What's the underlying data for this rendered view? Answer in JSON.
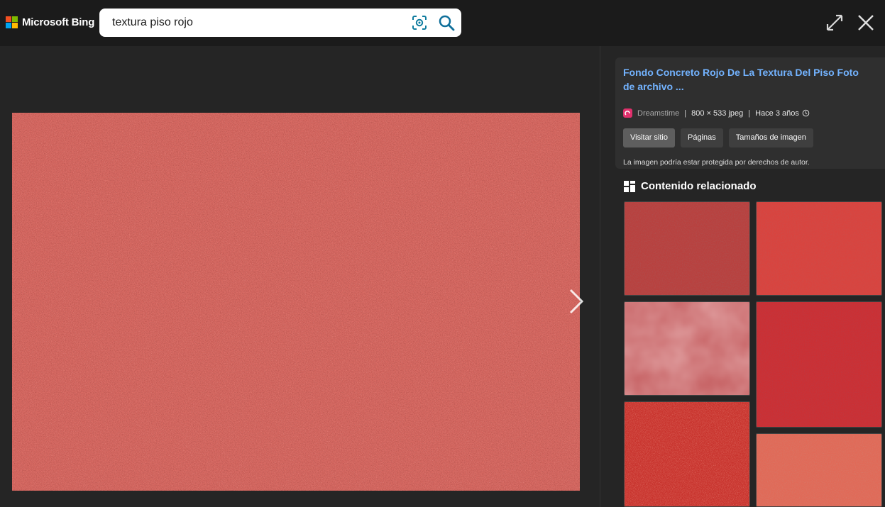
{
  "header": {
    "logo_text": "Microsoft Bing",
    "search_value": "textura piso rojo",
    "icons": {
      "visual_search": "visual-search-icon",
      "search": "search-icon",
      "expand": "expand-icon",
      "close": "close-icon"
    }
  },
  "viewer": {
    "next_icon": "chevron-right-icon",
    "image_color": "#d96a63"
  },
  "details": {
    "title": "Fondo Concreto Rojo De La Textura Del Piso Foto de archivo ...",
    "source": "Dreamstime",
    "dimensions": "800 × 533 jpeg",
    "age": "Hace 3 años",
    "buttons": {
      "visit": "Visitar sitio",
      "pages": "Páginas",
      "sizes": "Tamaños de imagen"
    },
    "copyright": "La imagen podría estar protegida por derechos de autor."
  },
  "related": {
    "heading": "Contenido relacionado",
    "thumb_colors": [
      "#b8413f",
      "#d8443f",
      "#c86668",
      "#cc2f33",
      "#c8332d",
      "#e06a58"
    ]
  },
  "colors": {
    "link": "#73b3ff",
    "background": "#252525",
    "topbar": "#1b1b1b"
  }
}
